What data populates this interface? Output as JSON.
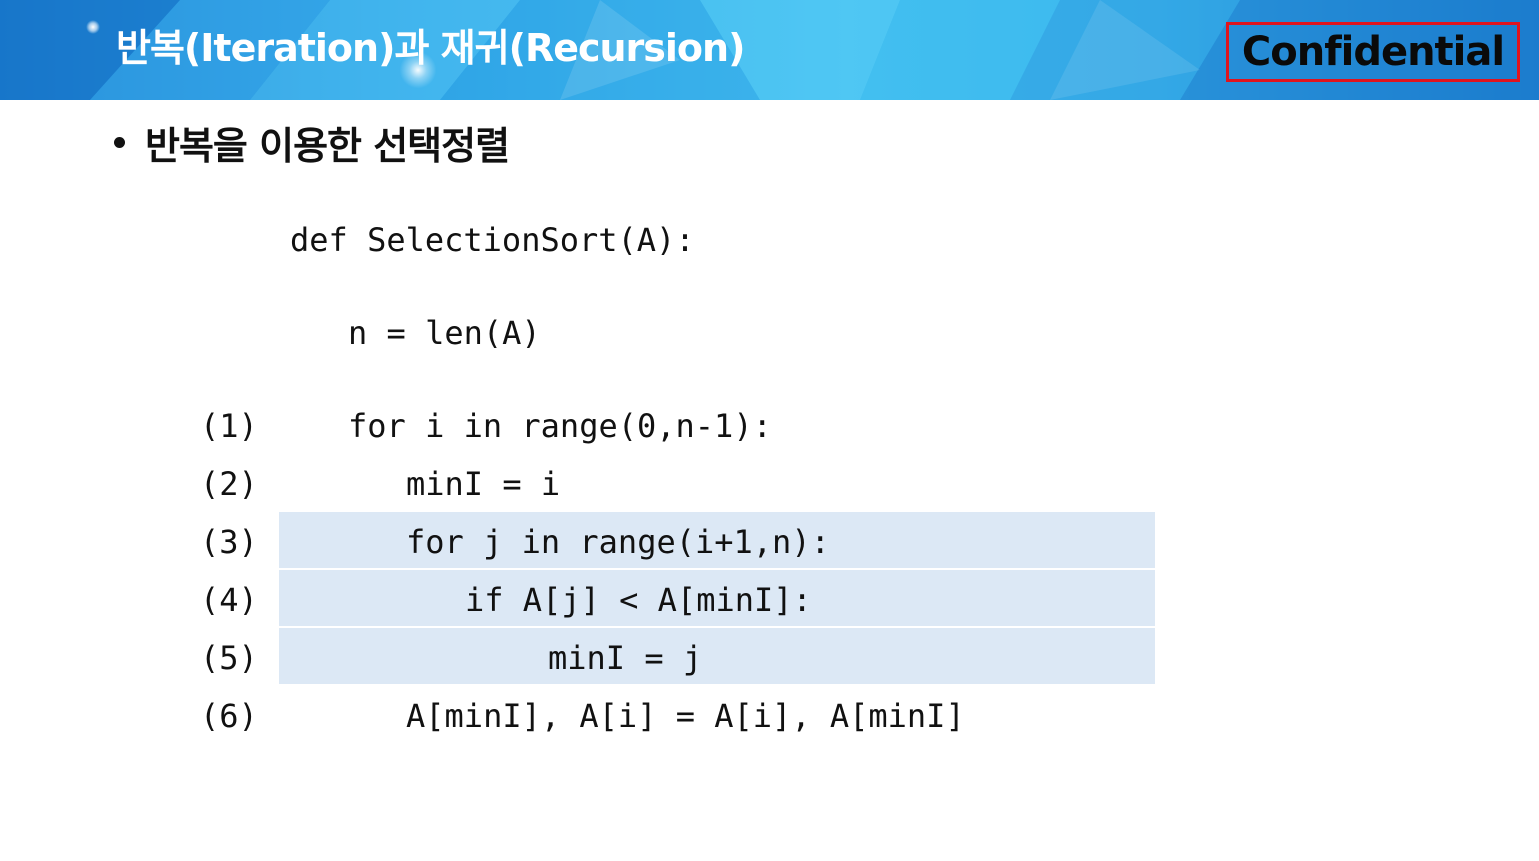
{
  "header": {
    "title": "반복(Iteration)과 재귀(Recursion)",
    "badge": "Confidential"
  },
  "bullet": {
    "text": "반복을 이용한 선택정렬"
  },
  "code": {
    "def_line": "def SelectionSort(A):",
    "n_line": "n = len(A)",
    "lines": [
      {
        "num": "(1)",
        "code": "for i in range(0,n-1):"
      },
      {
        "num": "(2)",
        "code": "minI = i"
      },
      {
        "num": "(3)",
        "code": "for j in range(i+1,n):"
      },
      {
        "num": "(4)",
        "code": "if A[j] < A[minI]:"
      },
      {
        "num": "(5)",
        "code": "minI = j"
      },
      {
        "num": "(6)",
        "code": "A[minI], A[i] = A[i], A[minI]"
      }
    ]
  },
  "colors": {
    "highlight": "#dce8f5",
    "badge_border": "#e0141e",
    "header_blue": "#2fa6e8"
  }
}
